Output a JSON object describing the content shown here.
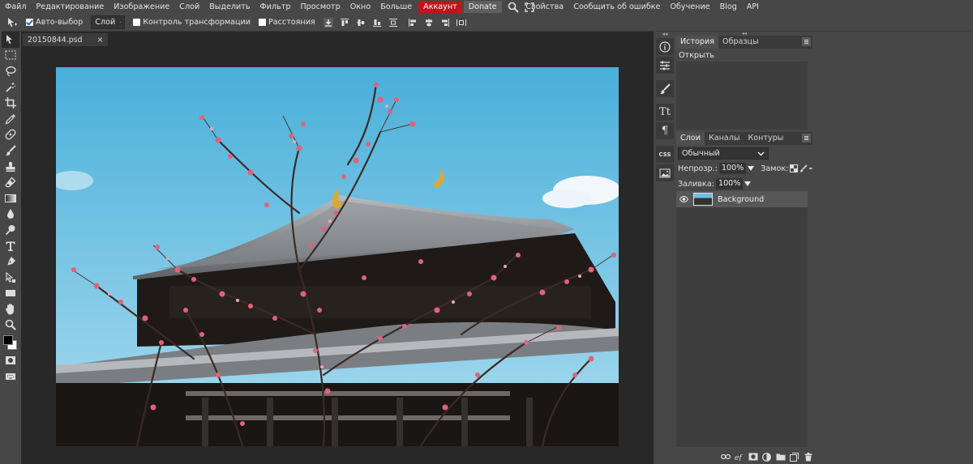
{
  "menu": {
    "items": [
      "Файл",
      "Редактирование",
      "Изображение",
      "Слой",
      "Выделить",
      "Фильтр",
      "Просмотр",
      "Окно",
      "Больше"
    ],
    "account": "Аккаунт",
    "donate": "Donate",
    "right_items": [
      "Свойства",
      "Сообщить об ошибке",
      "Обучение",
      "Blog",
      "API"
    ]
  },
  "options": {
    "auto_select_label": "Авто-выбор",
    "auto_select_checked": true,
    "target_select": "Слой",
    "transform_controls_label": "Контроль трансформации",
    "transform_controls_checked": false,
    "distances_label": "Расстояния",
    "distances_checked": false
  },
  "document": {
    "tab_name": "20150844.psd",
    "close_symbol": "×"
  },
  "history_panel": {
    "tabs": [
      "История",
      "Образцы"
    ],
    "items": [
      "Открыть"
    ]
  },
  "layers_panel": {
    "tabs": [
      "Слои",
      "Каналы",
      "Контуры"
    ],
    "blend_mode": "Обычный",
    "opacity_label": "Непрозр.:",
    "opacity_value": "100%",
    "lock_label": "Замок:",
    "fill_label": "Заливка:",
    "fill_value": "100%",
    "layers": [
      {
        "name": "Background",
        "visible": true
      }
    ]
  },
  "side_icons": {
    "text_icon_label": "Tt",
    "paragraph_icon_label": "¶",
    "css_label": "CSS"
  },
  "colors": {
    "accent_account": "#c0141b",
    "ui_bg": "#474747",
    "workspace_bg": "#282828",
    "foreground_swatch": "#000000",
    "background_swatch": "#ffffff"
  }
}
